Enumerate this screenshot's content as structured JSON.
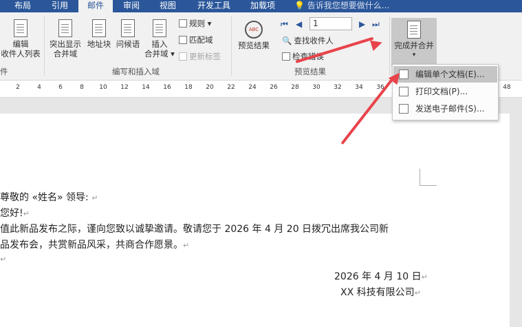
{
  "tabs": [
    "布局",
    "引用",
    "邮件",
    "审阅",
    "视图",
    "开发工具",
    "加载项"
  ],
  "active_tab": "邮件",
  "tell_me": "告诉我您想要做什么...",
  "ribbon": {
    "edit_recipients": {
      "line1": "编辑",
      "line2": "收件人列表"
    },
    "group1_label": "件",
    "highlight": {
      "line1": "突出显示",
      "line2": "合并域"
    },
    "address_block": "地址块",
    "greeting_line": "问候语",
    "insert_field": {
      "line1": "插入",
      "line2": "合并域 ▾"
    },
    "rules": "规则 ▾",
    "match_fields": "匹配域",
    "update_labels": "更新标签",
    "group2_label": "编写和插入域",
    "preview_results": "预览结果",
    "record_number": "1",
    "find_recipient": "查找收件人",
    "check_errors": "检查错误",
    "group3_label": "预览结果",
    "finish_merge": {
      "line1": "完成并合并",
      "line2": "▾"
    }
  },
  "ruler_ticks": [
    "2",
    "4",
    "6",
    "8",
    "10",
    "12",
    "14",
    "16",
    "18",
    "20",
    "22",
    "24",
    "26",
    "28",
    "30",
    "32",
    "34",
    "36",
    "48"
  ],
  "dropdown": {
    "items": [
      "编辑单个文档(E)...",
      "打印文档(P)...",
      "发送电子邮件(S)..."
    ]
  },
  "document": {
    "greeting": "尊敬的 «姓名»  领导:",
    "hello": "您好!",
    "body1": "值此新品发布之际，谨向您致以诚挚邀请。敬请您于 2026 年 4 月 20 日拨冗出席我公司新",
    "body2": "品发布会，共赏新品风采，共商合作愿景。",
    "date": "2026 年 4 月 10 日",
    "company": "XX 科技有限公司"
  },
  "colors": {
    "ribbon_blue": "#2b579a",
    "arrow_red": "#e8434a"
  }
}
